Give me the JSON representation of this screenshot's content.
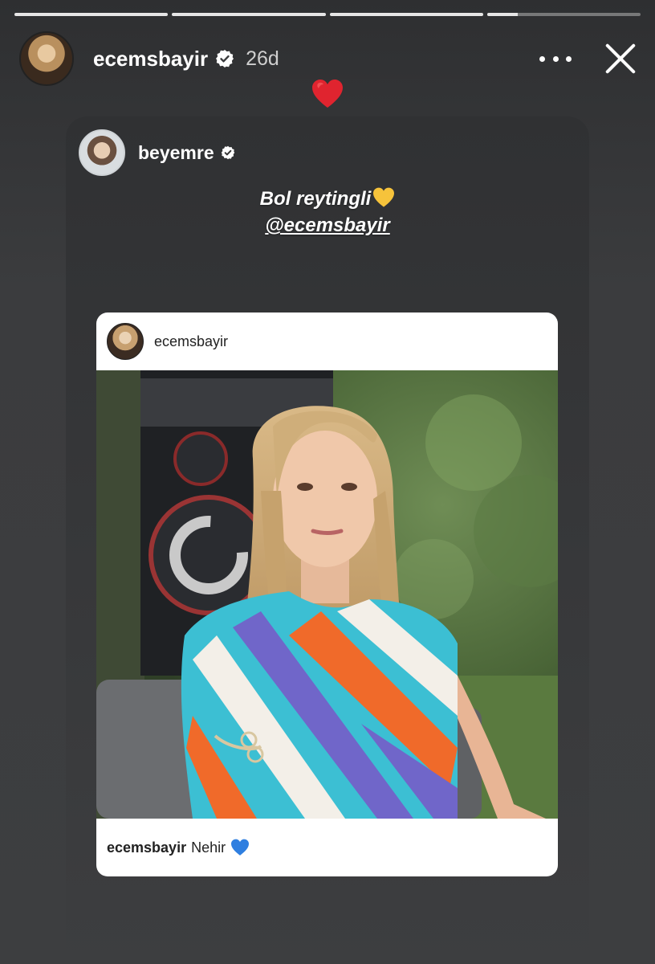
{
  "progress": [
    1,
    1,
    1,
    0.2
  ],
  "header": {
    "username": "ecemsbayir",
    "time": "26d"
  },
  "reaction": "red-heart",
  "reshare": {
    "username": "beyemre",
    "caption_line1": "Bol reytingli",
    "caption_mention": "@ecemsbayir"
  },
  "post": {
    "username": "ecemsbayir",
    "caption_user": "ecemsbayir",
    "caption_text": "Nehir"
  },
  "colors": {
    "background": "#3a3b3d",
    "heart_red": "#e0242f",
    "heart_yellow": "#f6c33b",
    "heart_blue": "#2f7fe0"
  }
}
